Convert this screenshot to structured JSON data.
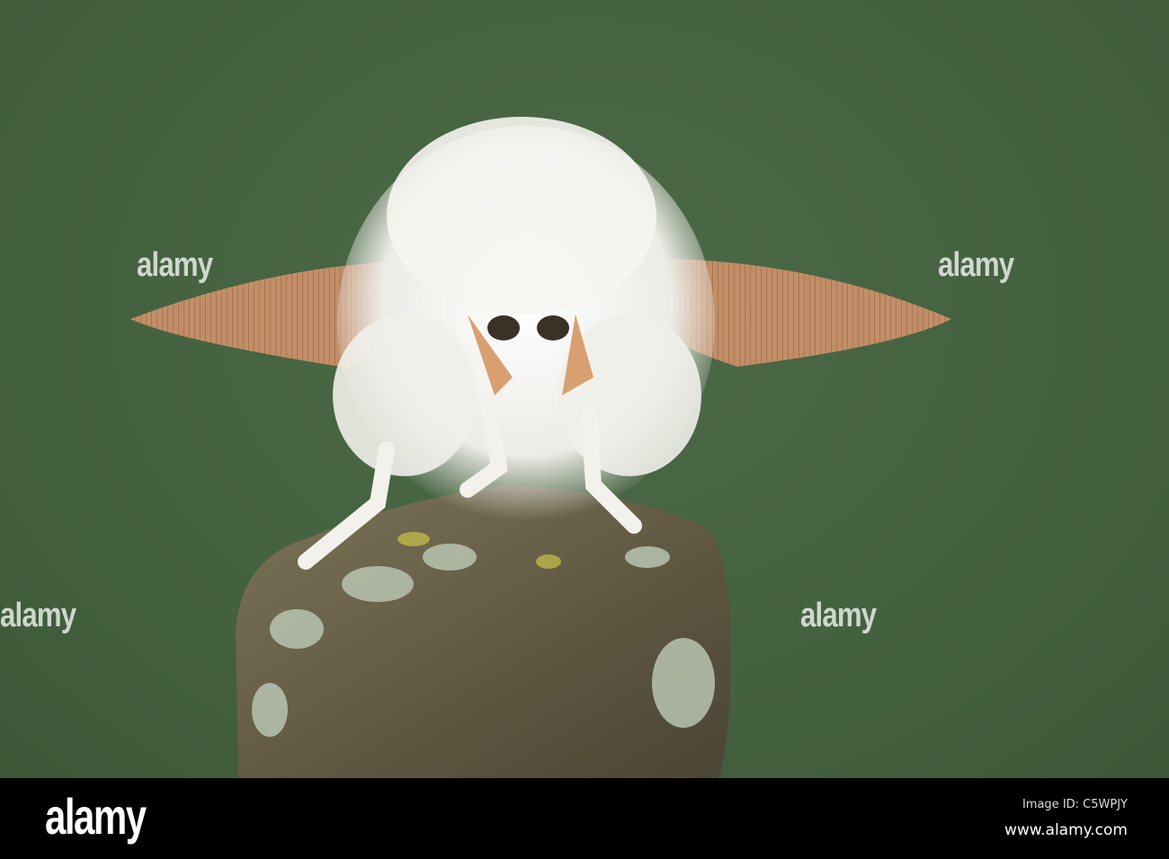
{
  "photo": {
    "subject": "White moth with feathered antennae on lichen-covered stump"
  },
  "watermark": {
    "text": "alamy"
  },
  "footer": {
    "logo": "alamy",
    "image_id": "Image ID: C5WPJY",
    "url": "www.alamy.com"
  },
  "colors": {
    "background": "#44613f",
    "antenna": "#c8906a",
    "fur": "#f4f2ee",
    "rock": "#6b6347"
  }
}
